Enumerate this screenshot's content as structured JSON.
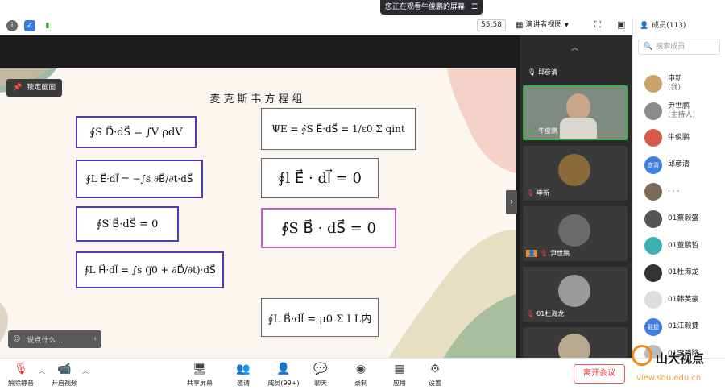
{
  "banner": {
    "sharing_text": "您正在观看牛俊鹏的屏幕"
  },
  "toolbar": {
    "timer": "55:58",
    "view_mode": "演讲者视图",
    "members_tab": "成员(113)"
  },
  "stage": {
    "lock_label": "锁定画面",
    "chat_placeholder": "说点什么..."
  },
  "slide": {
    "title": "麦克斯韦方程组",
    "eq1": "∮S D⃗·dS⃗ = ∫V ρdV",
    "eq2": "∮L E⃗·dl⃗ = −∫s ∂B⃗/∂t·dS⃗",
    "eq3": "∮S B⃗·dS⃗ = 0",
    "eq4": "∮L H⃗·dl⃗ = ∫s (j⃗0 + ∂D⃗/∂t)·dS⃗",
    "eq5": "ΨE = ∮S E⃗·dS⃗ = 1/ε0 Σ qint",
    "eq6": "∮l E⃗ · dl⃗ = 0",
    "eq7": "∮S B⃗ · dS⃗ = 0",
    "eq8": "∮L B⃗·dl⃗ = μ0 Σ I  L内"
  },
  "tiles": [
    "邱彦清",
    "牛俊鹏",
    "申新",
    "尹世鹏",
    "01杜海龙"
  ],
  "members": {
    "search_placeholder": "搜索成员",
    "items": [
      {
        "name": "申新",
        "sub": "(我)",
        "color": "#c9a36a"
      },
      {
        "name": "尹世鹏",
        "sub": "(主持人)",
        "color": "#8c8c8c"
      },
      {
        "name": "牛俊鹏",
        "sub": "",
        "color": "#d45a4a"
      },
      {
        "name": "邱彦清",
        "sub": "",
        "color": "#3f7fe0",
        "initials": "彦清"
      },
      {
        "name": "· · ·",
        "sub": "",
        "color": "#7a6a5a"
      },
      {
        "name": "01蔡毅盛",
        "sub": "",
        "color": "#555"
      },
      {
        "name": "01董鹏哲",
        "sub": "",
        "color": "#3fb0b0"
      },
      {
        "name": "01杜海龙",
        "sub": "",
        "color": "#333"
      },
      {
        "name": "01韩英豪",
        "sub": "",
        "color": "#ddd"
      },
      {
        "name": "01江毅捷",
        "sub": "",
        "color": "#3f7fe0",
        "initials": "毅捷"
      },
      {
        "name": "01李筠路",
        "sub": "",
        "color": "#bbb"
      }
    ]
  },
  "bottom": {
    "unmute": "解除静音",
    "video": "开启视频",
    "share": "共享屏幕",
    "invite": "邀请",
    "members": "成员(99+)",
    "chat": "聊天",
    "record": "录制",
    "apps": "应用",
    "settings": "设置",
    "leave": "离开会议"
  },
  "watermark": {
    "name": "山大视点",
    "url": "view.sdu.edu.cn"
  }
}
